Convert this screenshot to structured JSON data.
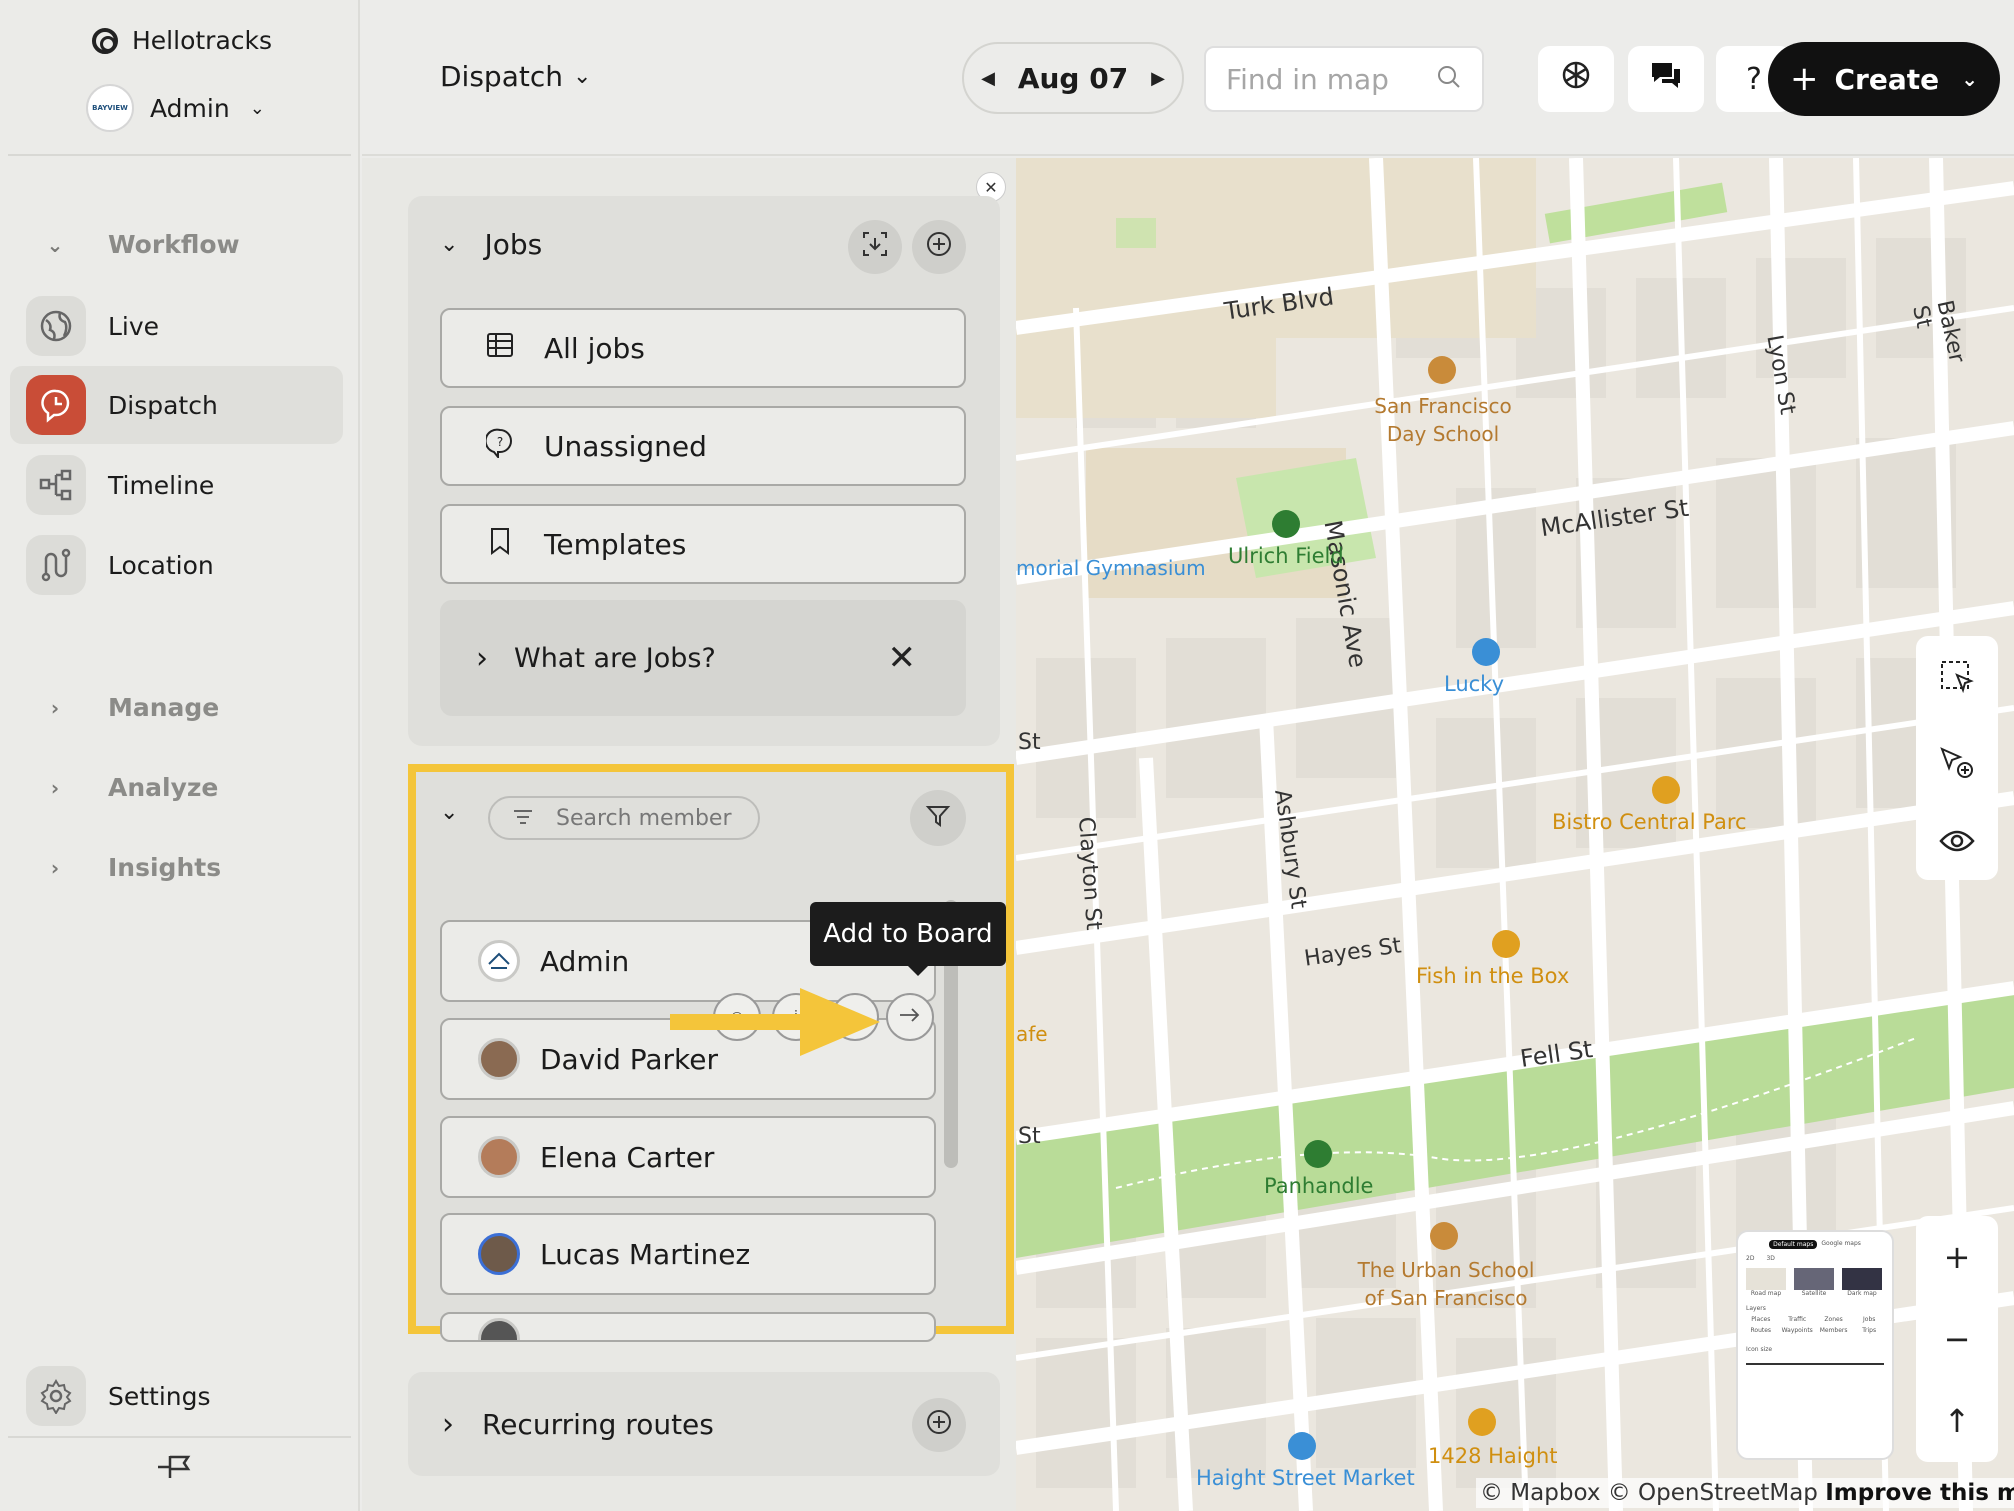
{
  "sidebar": {
    "brand": "Hellotracks",
    "account": "Admin",
    "groups": {
      "workflow": "Workflow",
      "manage": "Manage",
      "analyze": "Analyze",
      "insights": "Insights"
    },
    "items": [
      {
        "label": "Live",
        "icon": "globe-icon"
      },
      {
        "label": "Dispatch",
        "icon": "dispatch-pin-icon"
      },
      {
        "label": "Timeline",
        "icon": "timeline-icon"
      },
      {
        "label": "Location",
        "icon": "route-icon"
      }
    ],
    "settings": "Settings",
    "org_badge": "BAYVIEW"
  },
  "topbar": {
    "view": "Dispatch",
    "date": "Aug 07",
    "search_placeholder": "Find in map",
    "help": "?",
    "create": "Create"
  },
  "jobs": {
    "title": "Jobs",
    "rows": [
      "All jobs",
      "Unassigned",
      "Templates"
    ],
    "info": "What are Jobs?"
  },
  "members": {
    "search_placeholder": "Search member",
    "tooltip": "Add to Board",
    "list": [
      "Admin",
      "David Parker",
      "Elena Carter",
      "Lucas Martinez"
    ]
  },
  "recurring": {
    "title": "Recurring routes"
  },
  "map": {
    "streets": [
      "Turk Blvd",
      "McAllister St",
      "Masonic Ave",
      "Lyon St",
      "Baker St",
      "Clayton St",
      "Ashbury St",
      "Hayes St",
      "Fell St",
      "St",
      "St"
    ],
    "pois": [
      {
        "name": "San Francisco Day School",
        "color": "#c98b3a"
      },
      {
        "name": "Ulrich Field",
        "color": "#2e7d32"
      },
      {
        "name": "morial Gymnasium",
        "color": "#3a8fd6"
      },
      {
        "name": "Lucky",
        "color": "#3a8fd6"
      },
      {
        "name": "Bistro Central Parc",
        "color": "#e0a020"
      },
      {
        "name": "Fish in the Box",
        "color": "#e0a020"
      },
      {
        "name": "Panhandle",
        "color": "#2e7d32"
      },
      {
        "name": "The Urban School of San Francisco",
        "color": "#c98b3a"
      },
      {
        "name": "Haight Street Market",
        "color": "#3a8fd6"
      },
      {
        "name": "1428 Haight",
        "color": "#e0a020"
      },
      {
        "name": "afe",
        "color": "#e0a020"
      }
    ],
    "attribution": "© Mapbox © OpenStreetMap",
    "improve": "Improve this map",
    "thumb": {
      "tabs": [
        "Default maps",
        "Google maps"
      ],
      "modes": [
        "2D",
        "3D"
      ],
      "styles": [
        "Road map",
        "Satellite",
        "Dark map"
      ],
      "layers_title": "Layers",
      "layers": [
        "Places",
        "Traffic",
        "Zones",
        "Jobs",
        "Routes",
        "Waypoints",
        "Members",
        "Trips"
      ],
      "icon_size": "Icon size"
    }
  },
  "colors": {
    "accent": "#c94d37",
    "highlight": "#f4c53a",
    "dark": "#111111"
  }
}
